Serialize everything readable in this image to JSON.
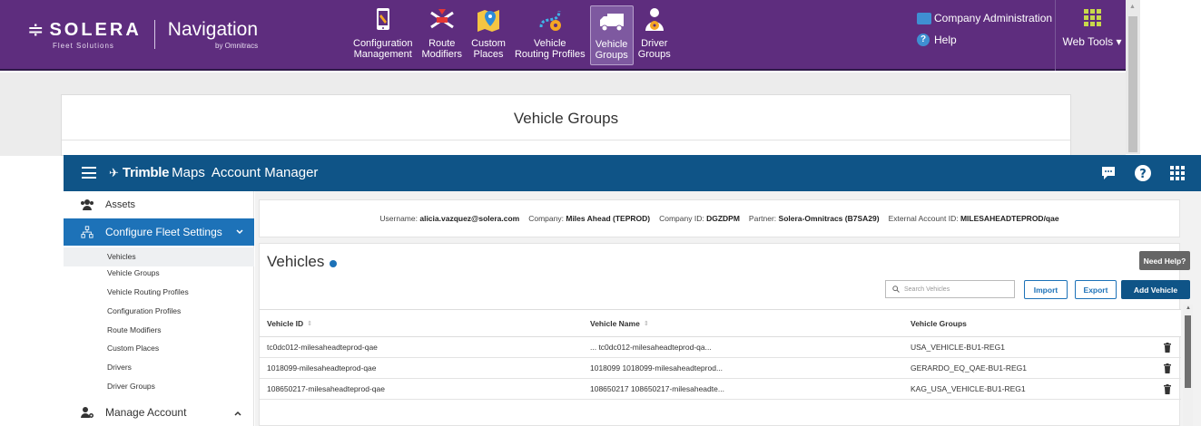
{
  "solera": {
    "brand": "SOLERA",
    "brand_sub": "Fleet Solutions",
    "product": "Navigation",
    "product_sub": "by Omnitracs",
    "nav": [
      {
        "line1": "Configuration",
        "line2": "Management"
      },
      {
        "line1": "Route",
        "line2": "Modifiers"
      },
      {
        "line1": "Custom",
        "line2": "Places"
      },
      {
        "line1": "Vehicle",
        "line2": "Routing Profiles"
      },
      {
        "line1": "Vehicle",
        "line2": "Groups"
      },
      {
        "line1": "Driver",
        "line2": "Groups"
      }
    ],
    "company_admin": "Company Administration",
    "help": "Help",
    "web_tools": "Web Tools",
    "page_title": "Vehicle Groups",
    "colors": {
      "header": "#5e2d7e",
      "active": "#7e59a0",
      "grid_icon": "#c8d84b"
    }
  },
  "trimble": {
    "brand_bold": "Trimble",
    "brand_maps": "Maps",
    "app_name": "Account Manager",
    "sidebar": {
      "assets": "Assets",
      "configure": "Configure Fleet Settings",
      "sub_items": [
        "Vehicles",
        "Vehicle Groups",
        "Vehicle Routing Profiles",
        "Configuration Profiles",
        "Route Modifiers",
        "Custom Places",
        "Drivers",
        "Driver Groups"
      ],
      "manage": "Manage Account"
    },
    "info": {
      "username_label": "Username:",
      "username": "alicia.vazquez@solera.com",
      "company_label": "Company:",
      "company": "Miles Ahead (TEPROD)",
      "company_id_label": "Company ID:",
      "company_id": "DGZDPM",
      "partner_label": "Partner:",
      "partner": "Solera-Omnitracs (B7SA29)",
      "external_label": "External Account ID:",
      "external_id": "MILESAHEADTEPROD/qae"
    },
    "vehicles": {
      "title": "Vehicles",
      "need_help": "Need Help?",
      "search_placeholder": "Search Vehicles",
      "import": "Import",
      "export": "Export",
      "add": "Add Vehicle",
      "columns": [
        "Vehicle ID",
        "Vehicle Name",
        "Vehicle Groups"
      ],
      "rows": [
        {
          "id": "tc0dc012-milesaheadteprod-qae",
          "name": "... tc0dc012-milesaheadteprod-qa...",
          "group": "USA_VEHICLE-BU1-REG1"
        },
        {
          "id": "1018099-milesaheadteprod-qae",
          "name": "1018099 1018099-milesaheadteprod...",
          "group": "GERARDO_EQ_QAE-BU1-REG1"
        },
        {
          "id": "108650217-milesaheadteprod-qae",
          "name": "108650217 108650217-milesaheadte...",
          "group": "KAG_USA_VEHICLE-BU1-REG1"
        }
      ]
    },
    "colors": {
      "header": "#0f5487",
      "active": "#1d72b8"
    }
  }
}
